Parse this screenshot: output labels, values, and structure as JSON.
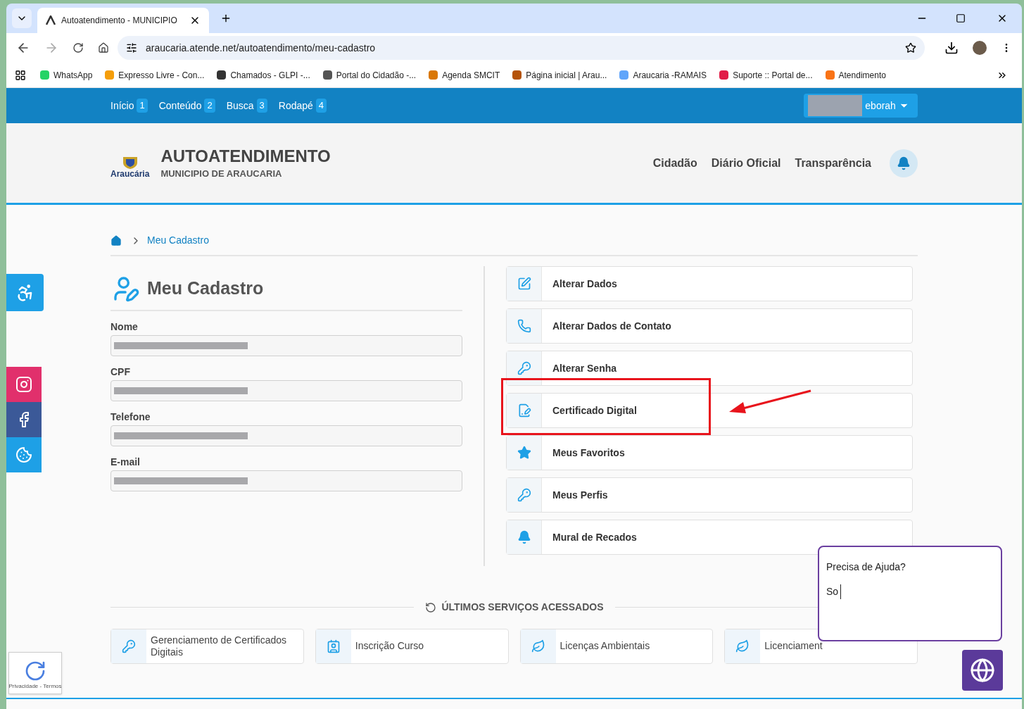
{
  "browser": {
    "tab_title": "Autoatendimento - MUNICIPIO",
    "url": "araucaria.atende.net/autoatendimento/meu-cadastro",
    "bookmarks": [
      {
        "label": "WhatsApp",
        "color": "#25d366"
      },
      {
        "label": "Expresso Livre - Con...",
        "color": "#f59e0b"
      },
      {
        "label": "Chamados - GLPI -...",
        "color": "#333333"
      },
      {
        "label": "Portal do Cidadão -...",
        "color": "#555555"
      },
      {
        "label": "Agenda SMCIT",
        "color": "#d97706"
      },
      {
        "label": "Página inicial | Arau...",
        "color": "#b45309"
      },
      {
        "label": "Araucaria -RAMAIS",
        "color": "#60a5fa"
      },
      {
        "label": "Suporte :: Portal de...",
        "color": "#e11d48"
      },
      {
        "label": "Atendimento",
        "color": "#f97316"
      }
    ]
  },
  "topnav": {
    "items": [
      {
        "label": "Início",
        "key": "1"
      },
      {
        "label": "Conteúdo",
        "key": "2"
      },
      {
        "label": "Busca",
        "key": "3"
      },
      {
        "label": "Rodapé",
        "key": "4"
      }
    ],
    "user": "eborah"
  },
  "header": {
    "logo": "Araucária",
    "title": "AUTOATENDIMENTO",
    "subtitle": "MUNICIPIO DE ARAUCARIA",
    "nav": [
      "Cidadão",
      "Diário Oficial",
      "Transparência"
    ]
  },
  "breadcrumb": "Meu Cadastro",
  "profile": {
    "heading": "Meu Cadastro",
    "fields": [
      {
        "label": "Nome"
      },
      {
        "label": "CPF"
      },
      {
        "label": "Telefone"
      },
      {
        "label": "E-mail"
      }
    ]
  },
  "actions": [
    {
      "label": "Alterar Dados",
      "kind": "edit",
      "highlighted": false
    },
    {
      "label": "Alterar Dados de Contato",
      "kind": "phone",
      "highlighted": false
    },
    {
      "label": "Alterar Senha",
      "kind": "key",
      "highlighted": false
    },
    {
      "label": "Certificado Digital",
      "kind": "cert",
      "highlighted": true
    },
    {
      "label": "Meus Favoritos",
      "kind": "star",
      "highlighted": false
    },
    {
      "label": "Meus Perfis",
      "kind": "key",
      "highlighted": false
    },
    {
      "label": "Mural de Recados",
      "kind": "bell",
      "highlighted": false
    }
  ],
  "recent": {
    "title": "ÚLTIMOS SERVIÇOS ACESSADOS",
    "items": [
      {
        "label": "Gerenciamento de Certificados Digitais",
        "kind": "key"
      },
      {
        "label": "Inscrição Curso",
        "kind": "badge"
      },
      {
        "label": "Licenças Ambientais",
        "kind": "leaf"
      },
      {
        "label": "Licenciament",
        "kind": "leaf"
      }
    ]
  },
  "chat": {
    "title": "Precisa de Ajuda?",
    "value": "So"
  },
  "recaptcha": "Privacidade - Termos"
}
